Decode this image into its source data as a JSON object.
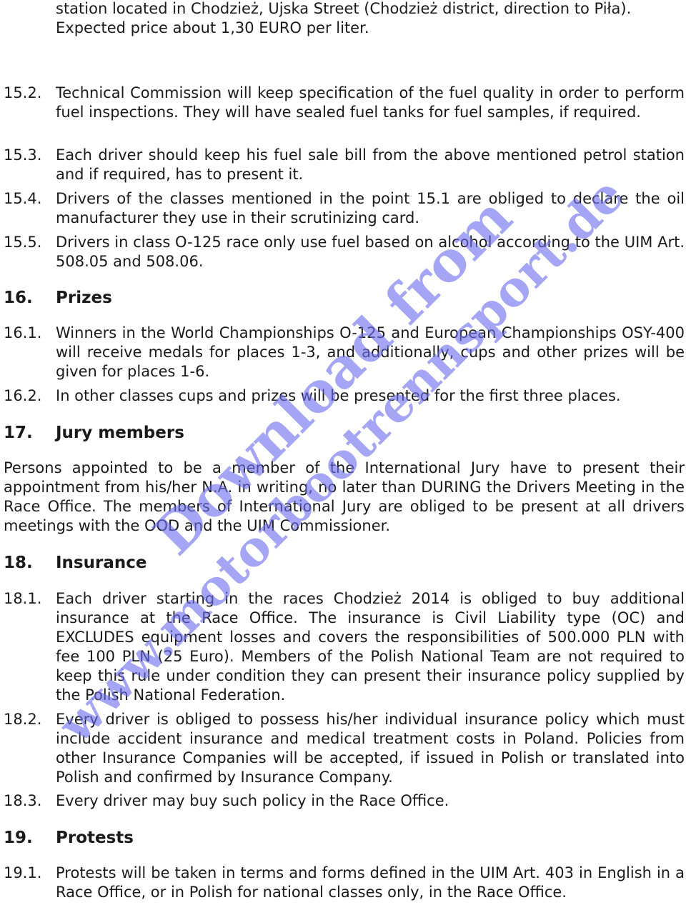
{
  "continuation": {
    "lines": [
      "station located in Chodzież, Ujska Street (Chodzież district, direction to Piła).",
      "Expected price about 1,30 EURO per liter."
    ]
  },
  "section15": {
    "items": [
      {
        "num": "15.2.",
        "text": "Technical Commission will keep specification of the fuel quality in order to perform fuel inspections. They will have sealed fuel tanks for fuel samples, if required."
      },
      {
        "num": "15.3.",
        "text": "Each driver should keep his fuel sale bill from the above mentioned petrol station and if required, has to present it."
      },
      {
        "num": "15.4.",
        "text": "Drivers of the classes mentioned in the point 15.1 are obliged to declare the oil manufacturer they use in their scrutinizing card."
      },
      {
        "num": "15.5.",
        "text": "Drivers in class O-125 race only use fuel based on alcohol according to the UIM Art. 508.05 and 508.06."
      }
    ]
  },
  "section16": {
    "num": "16.",
    "title": "Prizes",
    "items": [
      {
        "num": "16.1.",
        "text": "Winners in the World Championships O-125 and European Championships OSY-400 will receive medals for places 1-3, and additionally, cups and other prizes will be given for places 1-6."
      },
      {
        "num": "16.2.",
        "text": "In other classes cups and prizes will be presented for the first three places."
      }
    ]
  },
  "section17": {
    "num": "17.",
    "title": "Jury members",
    "paragraph": "Persons appointed to be a member of the International Jury have to present their appointment from his/her N.A. in writing, no later than DURING the Drivers Meeting in the Race Office. The members of International Jury are obliged to be present at all drivers meetings with the OOD and the UIM Commissioner."
  },
  "section18": {
    "num": "18.",
    "title": "Insurance",
    "items": [
      {
        "num": "18.1.",
        "text": "Each driver starting in the races Chodzież 2014 is obliged to buy additional insurance at the Race Office. The insurance is Civil Liability type (OC) and EXCLUDES equipment losses and covers the responsibilities of 500.000 PLN with fee 100 PLN (25 Euro). Members of the Polish National Team are not required to keep this rule under condition they can present their insurance policy supplied by the Polish National Federation."
      },
      {
        "num": "18.2.",
        "text": "Every driver is obliged to possess his/her individual insurance policy which must include accident insurance and medical treatment costs in Poland. Policies  from other Insurance Companies will be accepted, if issued in Polish or translated into Polish and confirmed by Insurance Company."
      },
      {
        "num": "18.3.",
        "text": "Every driver may buy such policy in the Race Office."
      }
    ]
  },
  "section19": {
    "num": "19.",
    "title": "Protests",
    "items": [
      {
        "num": "19.1.",
        "text": "Protests will be taken in terms and forms defined in the UIM Art. 403 in English in a Race Office, or in Polish for national classes only, in the Race Office."
      }
    ]
  },
  "watermark": {
    "line1": "Download from",
    "line2": "www.motorbootrennsport.de",
    "color": "#6e6ef0"
  }
}
